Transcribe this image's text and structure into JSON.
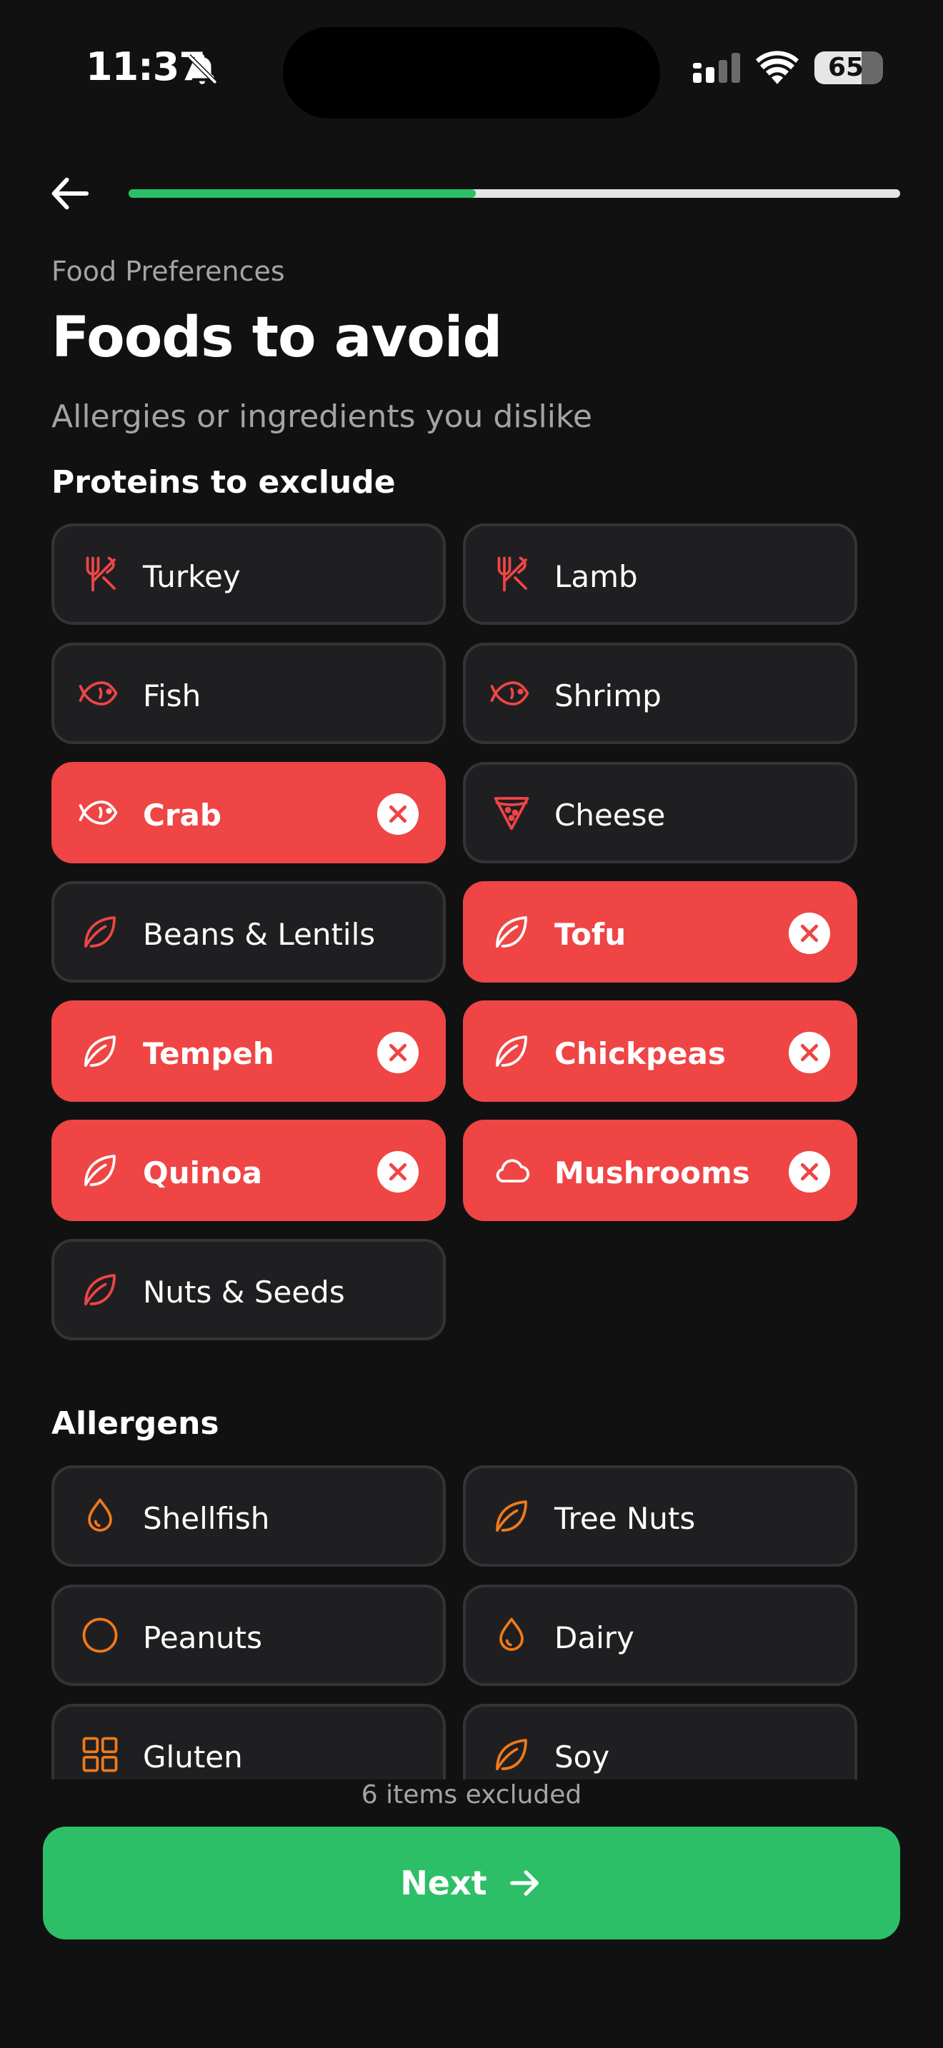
{
  "status_bar": {
    "time": "11:37",
    "battery": "65"
  },
  "header": {
    "progress": 0.45
  },
  "eyebrow": "Food Preferences",
  "title": "Foods to avoid",
  "subtitle": "Allergies or ingredients you dislike",
  "proteins": {
    "title": "Proteins to exclude",
    "items": [
      {
        "label": "Turkey",
        "icon": "utensils-icon",
        "selected": false
      },
      {
        "label": "Lamb",
        "icon": "utensils-icon",
        "selected": false
      },
      {
        "label": "Fish",
        "icon": "fish-icon",
        "selected": false
      },
      {
        "label": "Shrimp",
        "icon": "fish-icon",
        "selected": false
      },
      {
        "label": "Crab",
        "icon": "fish-icon",
        "selected": true
      },
      {
        "label": "Cheese",
        "icon": "pizza-icon",
        "selected": false
      },
      {
        "label": "Beans & Lentils",
        "icon": "leaf-icon",
        "selected": false
      },
      {
        "label": "Tofu",
        "icon": "leaf-icon",
        "selected": true
      },
      {
        "label": "Tempeh",
        "icon": "leaf-icon",
        "selected": true
      },
      {
        "label": "Chickpeas",
        "icon": "leaf-icon",
        "selected": true
      },
      {
        "label": "Quinoa",
        "icon": "leaf-icon",
        "selected": true
      },
      {
        "label": "Mushrooms",
        "icon": "cloud-icon",
        "selected": true
      },
      {
        "label": "Nuts & Seeds",
        "icon": "leaf-icon",
        "selected": false
      }
    ]
  },
  "allergens": {
    "title": "Allergens",
    "items": [
      {
        "label": "Shellfish",
        "icon": "droplet-icon",
        "selected": false
      },
      {
        "label": "Tree Nuts",
        "icon": "leaf-icon",
        "selected": false
      },
      {
        "label": "Peanuts",
        "icon": "circle-icon",
        "selected": false
      },
      {
        "label": "Dairy",
        "icon": "droplet-icon",
        "selected": false
      },
      {
        "label": "Gluten",
        "icon": "grid-icon",
        "selected": false
      },
      {
        "label": "Soy",
        "icon": "leaf-icon",
        "selected": false
      }
    ]
  },
  "footer": {
    "excluded_text": "6 items excluded",
    "next_label": "Next"
  },
  "colors": {
    "accent_red": "#ef4545",
    "protein_icon": "#ef4545",
    "allergen_icon": "#f07a1a",
    "green": "#2dbf67"
  }
}
